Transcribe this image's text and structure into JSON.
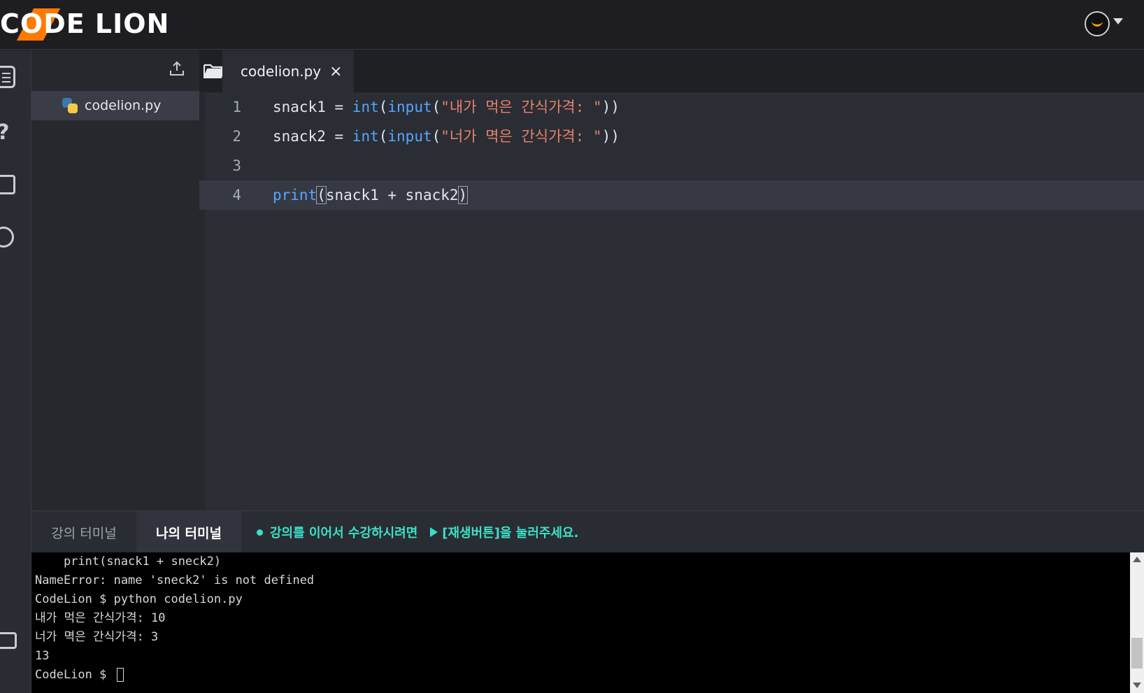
{
  "header": {
    "logo_text": "CODE LION",
    "avatar_icon": "lion-avatar-icon",
    "menu_icon": "caret-down-icon"
  },
  "rail": {
    "icons": [
      "list-icon",
      "help-icon",
      "folder-icon",
      "history-icon",
      "chat-icon"
    ]
  },
  "explorer": {
    "upload_icon": "upload-icon",
    "files": [
      {
        "name": "codelion.py",
        "icon": "python-icon",
        "selected": true
      }
    ]
  },
  "editor": {
    "open_tab": {
      "label": "codelion.py",
      "close": "×"
    },
    "lines": [
      {
        "num": "1",
        "parts": [
          [
            "snack1 = ",
            "plain"
          ],
          [
            "int",
            "kw"
          ],
          [
            "(",
            "plain"
          ],
          [
            "input",
            "kw"
          ],
          [
            "(",
            "plain"
          ],
          [
            "\"내가 먹은 간식가격: \"",
            "str"
          ],
          [
            "))",
            "plain"
          ]
        ]
      },
      {
        "num": "2",
        "parts": [
          [
            "snack2 = ",
            "plain"
          ],
          [
            "int",
            "kw"
          ],
          [
            "(",
            "plain"
          ],
          [
            "input",
            "kw"
          ],
          [
            "(",
            "plain"
          ],
          [
            "\"너가 멱은 간식가격: \"",
            "str"
          ],
          [
            "))",
            "plain"
          ]
        ]
      },
      {
        "num": "3",
        "parts": []
      },
      {
        "num": "4",
        "parts": [
          [
            "print",
            "kw"
          ],
          [
            "(",
            "brk"
          ],
          [
            "snack1 + snack2",
            "plain"
          ],
          [
            ")",
            "brk"
          ]
        ]
      }
    ],
    "active_line": 4
  },
  "terminal_panel": {
    "tabs": [
      {
        "label": "강의 터미널",
        "active": false
      },
      {
        "label": "나의 터미널",
        "active": true
      }
    ],
    "notice_text": "강의를 이어서 수강하시려면",
    "notice_action": "[재생버튼]을 눌러주세요.",
    "lines": [
      "    print(snack1 + sneck2)",
      "NameError: name 'sneck2' is not defined",
      "CodeLion $ python codelion.py",
      "내가 먹은 간식가격: 10",
      "너가 멱은 간식가격: 3",
      "13",
      "CodeLion $ "
    ]
  },
  "colors": {
    "accent": "#3be0c8",
    "logo_orange": "#ff7a00",
    "keyword": "#55a7ff",
    "string": "#e5826a"
  }
}
